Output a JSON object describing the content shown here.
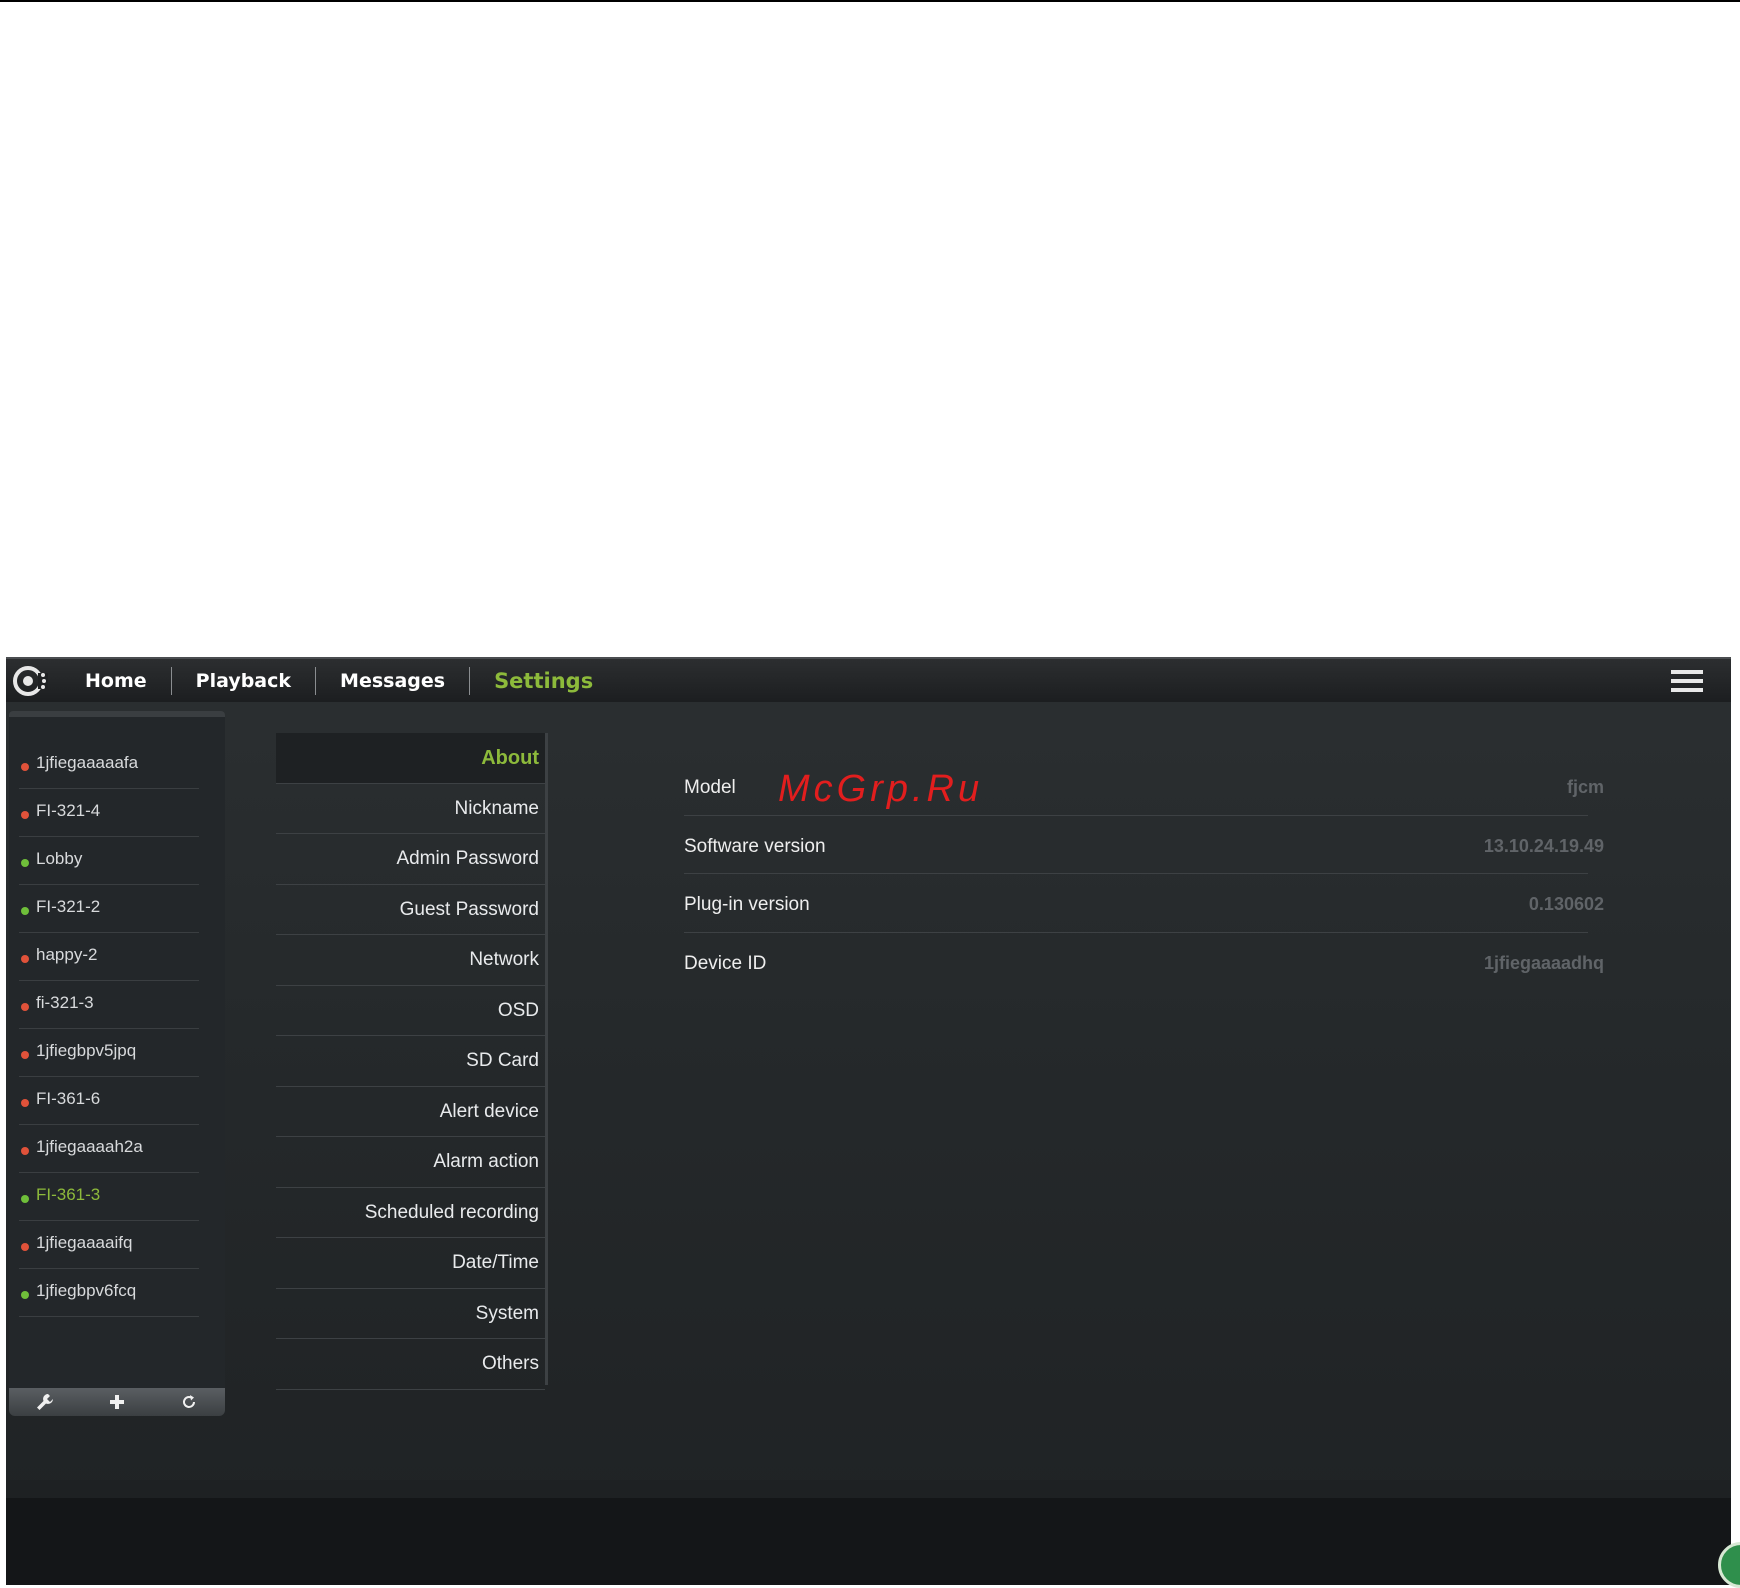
{
  "app": {
    "nav": [
      {
        "label": "Home",
        "active": false
      },
      {
        "label": "Playback",
        "active": false
      },
      {
        "label": "Messages",
        "active": false
      },
      {
        "label": "Settings",
        "active": true
      }
    ],
    "icons": {
      "logo": "app-logo-icon",
      "menu": "hamburger-menu-icon"
    }
  },
  "devices": [
    {
      "name": "1jfiegaaaaafa",
      "status": "offline"
    },
    {
      "name": "FI-321-4",
      "status": "offline"
    },
    {
      "name": "Lobby",
      "status": "online"
    },
    {
      "name": "FI-321-2",
      "status": "online"
    },
    {
      "name": "happy-2",
      "status": "offline"
    },
    {
      "name": "fi-321-3",
      "status": "offline"
    },
    {
      "name": "1jfiegbpv5jpq",
      "status": "offline"
    },
    {
      "name": "FI-361-6",
      "status": "offline"
    },
    {
      "name": "1jfiegaaaah2a",
      "status": "offline"
    },
    {
      "name": "FI-361-3",
      "status": "online",
      "selected": true
    },
    {
      "name": "1jfiegaaaaifq",
      "status": "offline"
    },
    {
      "name": "1jfiegbpv6fcq",
      "status": "online"
    }
  ],
  "device_toolbar": {
    "icons": [
      "wrench-icon",
      "plus-icon",
      "refresh-icon"
    ]
  },
  "settings_menu": [
    {
      "label": "About",
      "active": true
    },
    {
      "label": "Nickname"
    },
    {
      "label": "Admin Password"
    },
    {
      "label": "Guest Password"
    },
    {
      "label": "Network"
    },
    {
      "label": "OSD"
    },
    {
      "label": "SD Card"
    },
    {
      "label": "Alert device"
    },
    {
      "label": "Alarm action"
    },
    {
      "label": "Scheduled recording"
    },
    {
      "label": "Date/Time"
    },
    {
      "label": "System"
    },
    {
      "label": "Others"
    }
  ],
  "about": [
    {
      "label": "Model",
      "value": "fjcm"
    },
    {
      "label": "Software version",
      "value": "13.10.24.19.49"
    },
    {
      "label": "Plug-in version",
      "value": "0.130602"
    },
    {
      "label": "Device ID",
      "value": "1jfiegaaaadhq"
    }
  ],
  "watermark": "McGrp.Ru",
  "colors": {
    "accent": "#8dba3b",
    "online": "#6fbf3a",
    "offline": "#e0523a"
  }
}
